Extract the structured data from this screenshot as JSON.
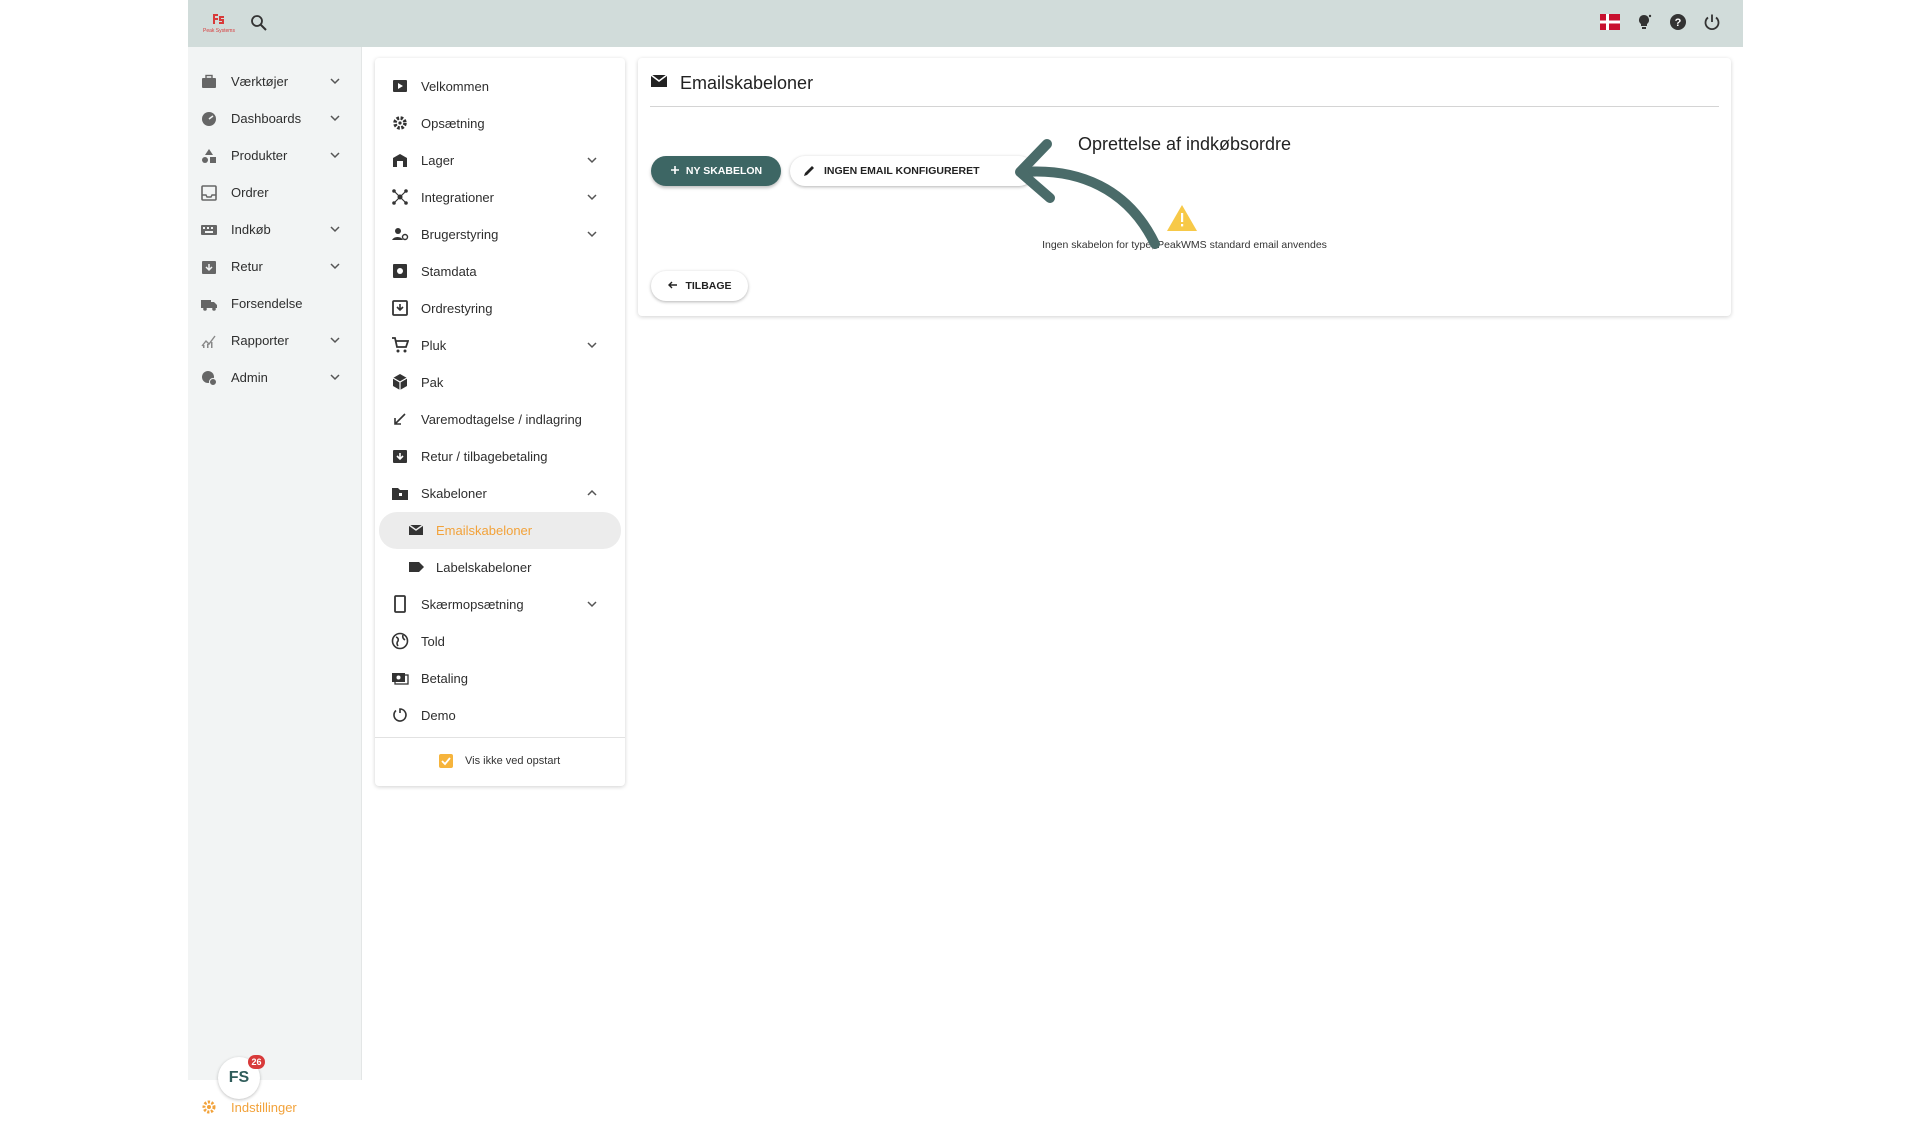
{
  "brand": {
    "logo_text": "Peak Systems"
  },
  "topbar": {
    "icons": [
      "search-icon",
      "danish-flag-icon",
      "lightbulb-icon",
      "help-icon",
      "power-icon"
    ]
  },
  "sidebar": {
    "items": [
      {
        "label": "Værktøjer",
        "icon": "toolbox-icon",
        "expandable": true
      },
      {
        "label": "Dashboards",
        "icon": "gauge-icon",
        "expandable": true
      },
      {
        "label": "Produkter",
        "icon": "shapes-icon",
        "expandable": true
      },
      {
        "label": "Ordrer",
        "icon": "inbox-icon",
        "expandable": false
      },
      {
        "label": "Indkøb",
        "icon": "keyboard-icon",
        "expandable": true
      },
      {
        "label": "Retur",
        "icon": "return-box-icon",
        "expandable": true
      },
      {
        "label": "Forsendelse",
        "icon": "truck-icon",
        "expandable": false
      },
      {
        "label": "Rapporter",
        "icon": "analytics-icon",
        "expandable": true
      },
      {
        "label": "Admin",
        "icon": "admin-gear-icon",
        "expandable": true
      }
    ],
    "badge_text": "FS",
    "badge_count": "26",
    "settings_label": "Indstillinger"
  },
  "settings_menu": {
    "items": [
      {
        "label": "Velkommen",
        "icon": "play-icon",
        "expandable": false
      },
      {
        "label": "Opsætning",
        "icon": "settings-cog-icon",
        "expandable": false
      },
      {
        "label": "Lager",
        "icon": "warehouse-icon",
        "expandable": true
      },
      {
        "label": "Integrationer",
        "icon": "hub-icon",
        "expandable": true
      },
      {
        "label": "Brugerstyring",
        "icon": "user-gear-icon",
        "expandable": true
      },
      {
        "label": "Stamdata",
        "icon": "master-data-icon",
        "expandable": false
      },
      {
        "label": "Ordrestyring",
        "icon": "order-control-icon",
        "expandable": false
      },
      {
        "label": "Pluk",
        "icon": "cart-icon",
        "expandable": true
      },
      {
        "label": "Pak",
        "icon": "package-icon",
        "expandable": false
      },
      {
        "label": "Varemodtagelse / indlagring",
        "icon": "arrow-down-left-icon",
        "expandable": false
      },
      {
        "label": "Retur / tilbagebetaling",
        "icon": "refund-icon",
        "expandable": false
      },
      {
        "label": "Skabeloner",
        "icon": "folder-icon",
        "expandable": true,
        "expanded": true
      },
      {
        "label": "Emailskabeloner",
        "icon": "mail-icon",
        "sub": true,
        "active": true
      },
      {
        "label": "Labelskabeloner",
        "icon": "label-icon",
        "sub": true
      },
      {
        "label": "Skærmopsætning",
        "icon": "phone-icon",
        "expandable": true
      },
      {
        "label": "Told",
        "icon": "globe-icon",
        "expandable": false
      },
      {
        "label": "Betaling",
        "icon": "payments-icon",
        "expandable": false
      },
      {
        "label": "Demo",
        "icon": "timer-icon",
        "expandable": false
      }
    ],
    "startup_label": "Vis ikke ved opstart",
    "startup_checked": true
  },
  "content": {
    "title": "Emailskabeloner",
    "section_title": "Oprettelse af indkøbsordre",
    "new_button": "NY SKABELON",
    "email_button": "INGEN EMAIL KONFIGURERET",
    "warning_text": "Ingen skabelon for type, PeakWMS standard email anvendes",
    "back_button": "TILBAGE"
  },
  "colors": {
    "topbar": "#d1dcda",
    "accent_orange": "#f2a23a",
    "primary_teal": "#3d6664",
    "warning_yellow": "#f7c948"
  }
}
